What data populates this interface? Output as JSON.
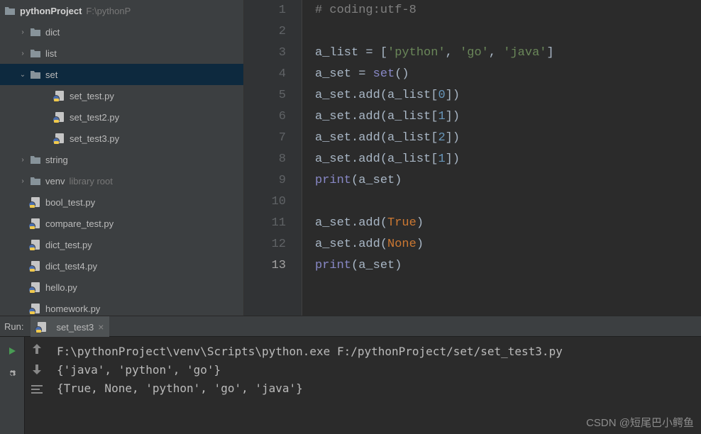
{
  "sidebar": {
    "project_name": "pythonProject",
    "project_path": "F:\\pythonP",
    "items": [
      {
        "label": "dict",
        "type": "folder",
        "indent": 1,
        "expanded": false
      },
      {
        "label": "list",
        "type": "folder",
        "indent": 1,
        "expanded": false
      },
      {
        "label": "set",
        "type": "folder",
        "indent": 1,
        "expanded": true,
        "selected": true
      },
      {
        "label": "set_test.py",
        "type": "py",
        "indent": 3
      },
      {
        "label": "set_test2.py",
        "type": "py",
        "indent": 3
      },
      {
        "label": "set_test3.py",
        "type": "py",
        "indent": 3
      },
      {
        "label": "string",
        "type": "folder",
        "indent": 1,
        "expanded": false
      },
      {
        "label": "venv",
        "type": "folder",
        "indent": 1,
        "expanded": false,
        "hint": "library root"
      },
      {
        "label": "bool_test.py",
        "type": "py",
        "indent": 2
      },
      {
        "label": "compare_test.py",
        "type": "py",
        "indent": 2
      },
      {
        "label": "dict_test.py",
        "type": "py",
        "indent": 2
      },
      {
        "label": "dict_test4.py",
        "type": "py",
        "indent": 2
      },
      {
        "label": "hello.py",
        "type": "py",
        "indent": 2
      },
      {
        "label": "homework.py",
        "type": "py",
        "indent": 2
      }
    ]
  },
  "editor": {
    "lines": [
      {
        "n": 1,
        "tokens": [
          {
            "t": "# coding:utf-8",
            "c": "c-comment"
          }
        ]
      },
      {
        "n": 2,
        "tokens": []
      },
      {
        "n": 3,
        "tokens": [
          {
            "t": "a_list = ["
          },
          {
            "t": "'python'",
            "c": "c-string"
          },
          {
            "t": ", "
          },
          {
            "t": "'go'",
            "c": "c-string"
          },
          {
            "t": ", "
          },
          {
            "t": "'java'",
            "c": "c-string"
          },
          {
            "t": "]"
          }
        ]
      },
      {
        "n": 4,
        "tokens": [
          {
            "t": "a_set = "
          },
          {
            "t": "set",
            "c": "c-builtin"
          },
          {
            "t": "()"
          }
        ]
      },
      {
        "n": 5,
        "tokens": [
          {
            "t": "a_set.add(a_list["
          },
          {
            "t": "0",
            "c": "c-number"
          },
          {
            "t": "])"
          }
        ]
      },
      {
        "n": 6,
        "tokens": [
          {
            "t": "a_set.add(a_list["
          },
          {
            "t": "1",
            "c": "c-number"
          },
          {
            "t": "])"
          }
        ]
      },
      {
        "n": 7,
        "tokens": [
          {
            "t": "a_set.add(a_list["
          },
          {
            "t": "2",
            "c": "c-number"
          },
          {
            "t": "])"
          }
        ]
      },
      {
        "n": 8,
        "tokens": [
          {
            "t": "a_set.add(a_list["
          },
          {
            "t": "1",
            "c": "c-number"
          },
          {
            "t": "])"
          }
        ]
      },
      {
        "n": 9,
        "tokens": [
          {
            "t": "print",
            "c": "c-builtin"
          },
          {
            "t": "(a_set)"
          }
        ]
      },
      {
        "n": 10,
        "tokens": []
      },
      {
        "n": 11,
        "tokens": [
          {
            "t": "a_set.add("
          },
          {
            "t": "True",
            "c": "c-const"
          },
          {
            "t": ")"
          }
        ]
      },
      {
        "n": 12,
        "tokens": [
          {
            "t": "a_set.add("
          },
          {
            "t": "None",
            "c": "c-const"
          },
          {
            "t": ")"
          }
        ]
      },
      {
        "n": 13,
        "tokens": [
          {
            "t": "print",
            "c": "c-builtin"
          },
          {
            "t": "(a_set)"
          }
        ]
      }
    ],
    "active_line": 13
  },
  "run": {
    "panel_label": "Run:",
    "tab_name": "set_test3",
    "output": [
      "F:\\pythonProject\\venv\\Scripts\\python.exe F:/pythonProject/set/set_test3.py",
      "{'java', 'python', 'go'}",
      "{True, None, 'python', 'go', 'java'}"
    ]
  },
  "watermark": "CSDN @短尾巴小鳄鱼"
}
